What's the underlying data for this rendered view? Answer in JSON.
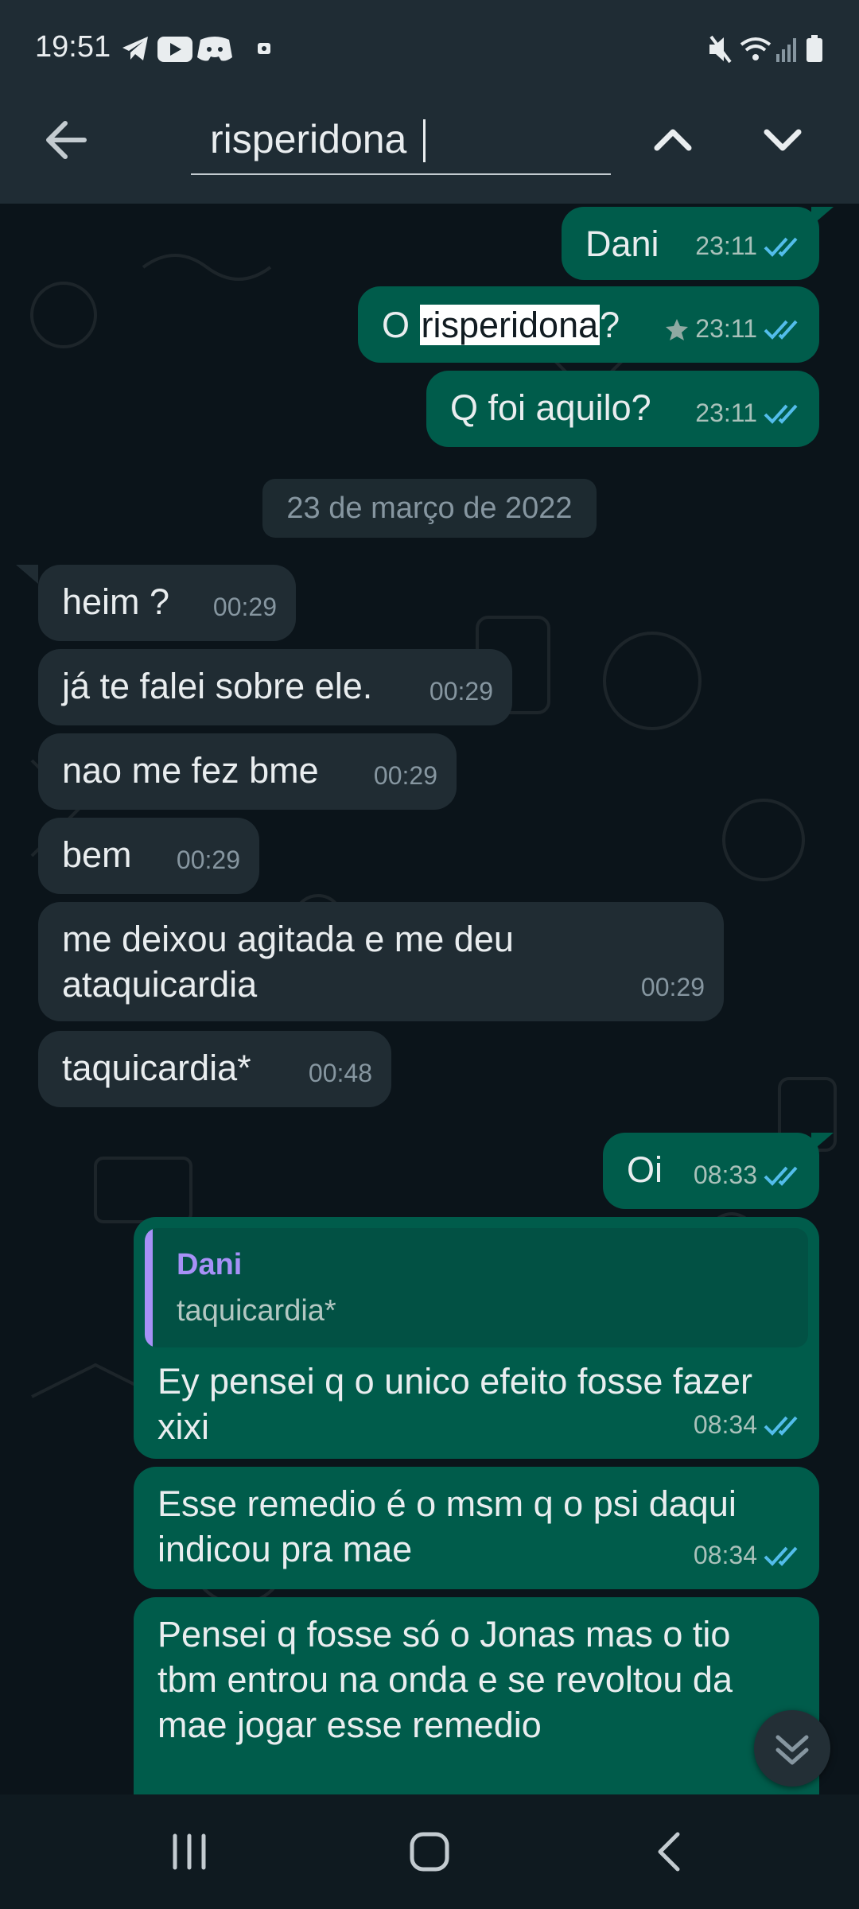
{
  "status_bar": {
    "time": "19:51"
  },
  "search": {
    "query": "risperidona"
  },
  "messages": [
    {
      "text": "Dani",
      "time": "23:11"
    },
    {
      "prefix": "O ",
      "highlight": "risperidona",
      "suffix": "?",
      "time": "23:11"
    },
    {
      "text": "Q foi aquilo?",
      "time": "23:11"
    },
    {
      "text": "heim ?",
      "time": "00:29"
    },
    {
      "text": "já te falei sobre ele.",
      "time": "00:29"
    },
    {
      "text": "nao me fez bme",
      "time": "00:29"
    },
    {
      "text": "bem",
      "time": "00:29"
    },
    {
      "text": "me deixou agitada e me deu\nataquicardia",
      "time": "00:29"
    },
    {
      "text": "taquicardia*",
      "time": "00:48"
    },
    {
      "text": "Oi",
      "time": "08:33"
    },
    {
      "quote_name": "Dani",
      "quote_text": "taquicardia*",
      "text": "Ey pensei q o unico efeito fosse fazer\nxixi",
      "time": "08:34"
    },
    {
      "text": "Esse remedio é o msm q o psi daqui\nindicou pra mae",
      "time": "08:34"
    },
    {
      "text": "Pensei q fosse só o Jonas mas o tio\ntbm entrou na onda e se revoltou da\nmae jogar esse remedio"
    }
  ],
  "date_separator": "23 de março de 2022",
  "colors": {
    "outgoing_bubble": "#005c4b",
    "incoming_bubble": "#202c33",
    "read_ticks": "#53bdeb",
    "header": "#1f2c34"
  }
}
